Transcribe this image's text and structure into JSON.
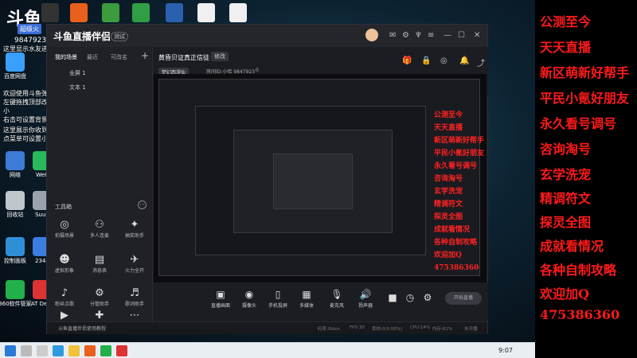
{
  "watermark": {
    "logo": "斗鱼",
    "badge": "超级火",
    "room_id": "9847923"
  },
  "overlay_lines": [
    "这里显示水友进场消息",
    "欢迎使用斗鱼弹幕助手",
    "左键拖拽顶部改变位置，右键拉伸边框改变大小",
    "右击可设置背景",
    "这里展示你收到的礼物、道具、贵族开通",
    "点菜单可设置小礼物屏蔽"
  ],
  "desktop_icons": [
    {
      "label": "百度网盘",
      "color": "#3aa0ff"
    },
    {
      "label": "网络",
      "color": "#3c7bd6"
    },
    {
      "label": "回收站",
      "color": "#bfc6cc"
    },
    {
      "label": "控制面板",
      "color": "#2f8fd6"
    },
    {
      "label": "360软件管家",
      "color": "#22b04a"
    },
    {
      "label": "WeC",
      "color": "#29b85b"
    },
    {
      "label": "Suun",
      "color": "#9aa3ad"
    },
    {
      "label": "2345",
      "color": "#3b7de0"
    },
    {
      "label": "AT Desk",
      "color": "#d33"
    }
  ],
  "app": {
    "logo": "斗鱼直播伴侣",
    "version": "测试",
    "left_tabs": [
      "我的场景",
      "最近",
      "可改名"
    ],
    "scenes": [
      "全屏 1",
      "文本 1"
    ],
    "tools_title": "工具箱",
    "tools": [
      {
        "label": "拍摄场景",
        "icon": "◎"
      },
      {
        "label": "多人连麦",
        "icon": "⚇"
      },
      {
        "label": "抽奖助手",
        "icon": "✦"
      },
      {
        "label": "虚拟形象",
        "icon": "☻"
      },
      {
        "label": "消息表",
        "icon": "▤"
      },
      {
        "label": "火力全开",
        "icon": "✈"
      },
      {
        "label": "粉丝点歌",
        "icon": "♪"
      },
      {
        "label": "分管助手",
        "icon": "⚙"
      },
      {
        "label": "歌词助手",
        "icon": "♬"
      },
      {
        "label": "直播",
        "icon": "▶"
      },
      {
        "label": "互动",
        "icon": "✚"
      },
      {
        "label": "更多",
        "icon": "⋯"
      }
    ],
    "room_title": "黄昏贝证真正信徒",
    "room_edit": "修改",
    "room_category": "梦幻西游仙",
    "room_id_text": "房间ID:小哈 9847923",
    "room_fans": "0",
    "bottom_buttons": [
      {
        "label": "直播画面",
        "icon": "▣"
      },
      {
        "label": "摄像头",
        "icon": "◉"
      },
      {
        "label": "手机投屏",
        "icon": "▯"
      },
      {
        "label": "多媒体",
        "icon": "▦"
      },
      {
        "label": "麦克风",
        "icon": "🎙"
      },
      {
        "label": "扬声器",
        "icon": "🔊"
      }
    ],
    "start_live": "开始直播",
    "status_hint": "斗鱼直播伴侣使用教程",
    "status": [
      "码率:0kb/s",
      "FPS:30",
      "丢帧:0(0.00%)",
      "CPU:14%",
      "内存:61%",
      "未开播"
    ]
  },
  "taskbar": {
    "time": "9:07"
  },
  "right_panel_lines": [
    "公测至今",
    "天天直播",
    "新区萌新好帮手",
    "平民小氪好朋友",
    "永久看号调号",
    "咨询淘号",
    "玄学洗宠",
    "精调符文",
    "探灵全图",
    "成就看情况",
    "各种自制攻略",
    "欢迎加Q",
    "475386360"
  ],
  "colors": {
    "accent_red": "#ff1a1a",
    "app_bg": "#1c1d22"
  }
}
